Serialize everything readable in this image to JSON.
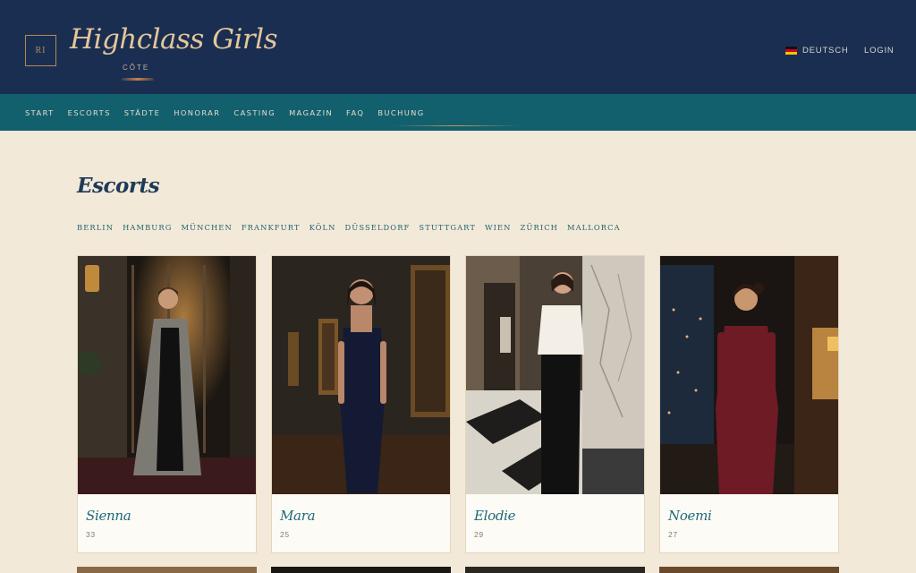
{
  "header": {
    "logo_initials": "RI",
    "brand_title": "Highclass Girls",
    "brand_subtitle": "CÔTE",
    "language_label": "DEUTSCH",
    "login_label": "LOGIN"
  },
  "nav": {
    "items": [
      "START",
      "ESCORTS",
      "STÄDTE",
      "HONORAR",
      "CASTING",
      "MAGAZIN",
      "FAQ",
      "BUCHUNG"
    ]
  },
  "main": {
    "title": "Escorts",
    "cities": [
      "BERLIN",
      "HAMBURG",
      "MÜNCHEN",
      "FRANKFURT",
      "KÖLN",
      "DÜSSELDORF",
      "STUTTGART",
      "WIEN",
      "ZÜRICH",
      "MALLORCA"
    ]
  },
  "cards": [
    {
      "name": "Sienna",
      "age": "33"
    },
    {
      "name": "Mara",
      "age": "25"
    },
    {
      "name": "Elodie",
      "age": "29"
    },
    {
      "name": "Noemi",
      "age": "27"
    }
  ],
  "colors": {
    "header_bg": "#1a2e52",
    "nav_bg": "#12606e",
    "page_bg": "#f3e9d8",
    "accent_gold": "#b5894f",
    "name_teal": "#1f6a78"
  }
}
